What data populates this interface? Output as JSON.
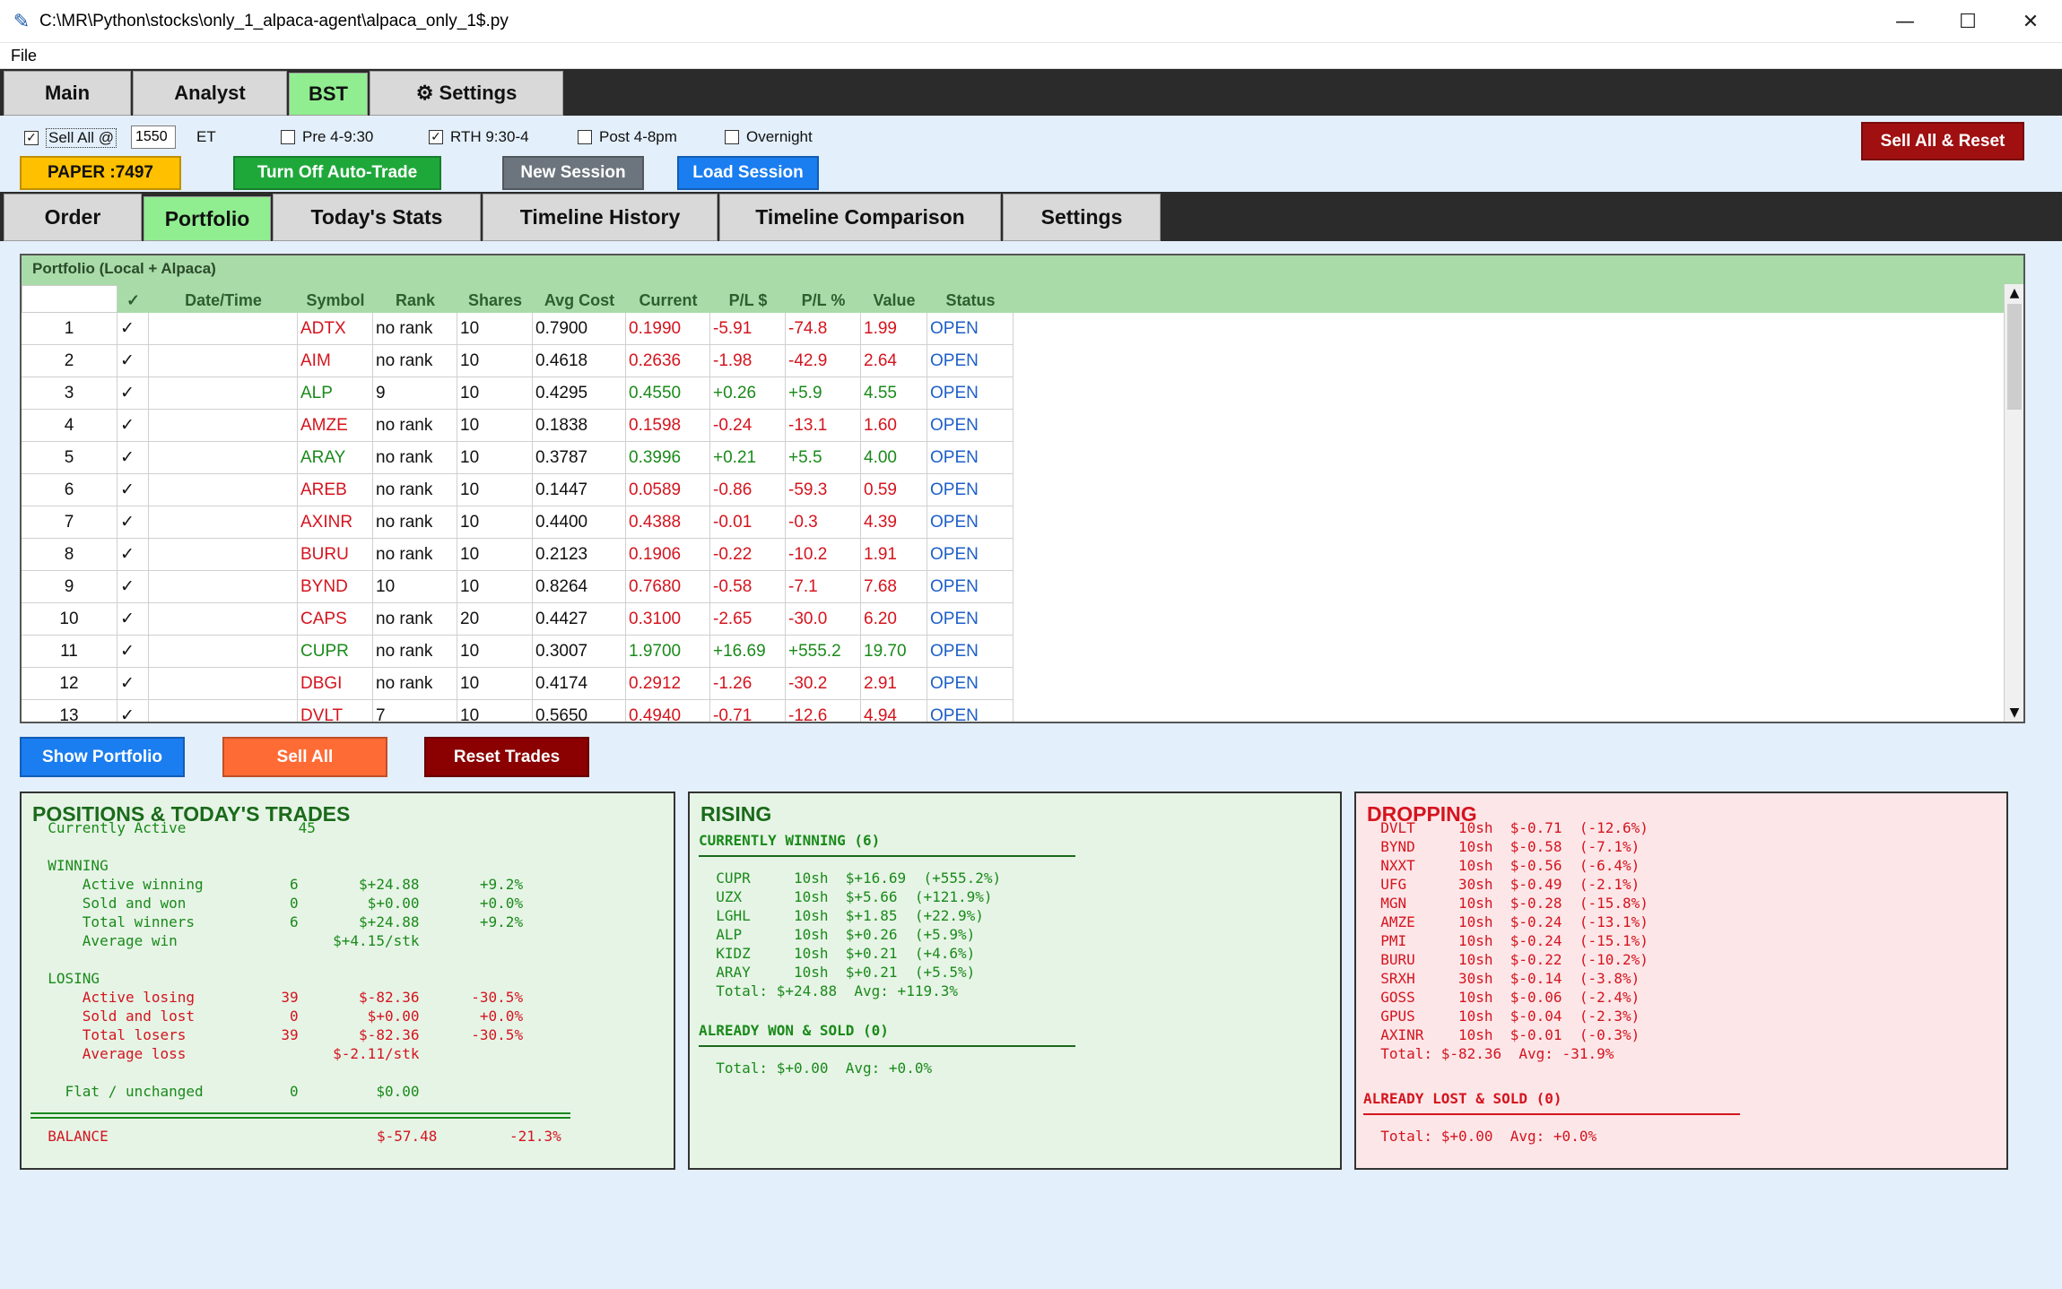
{
  "window": {
    "title": "C:\\MR\\Python\\stocks\\only_1_alpaca-agent\\alpaca_only_1$.py",
    "minimize": "—",
    "maximize": "☐",
    "close": "✕"
  },
  "menu": {
    "file": "File"
  },
  "top_tabs": [
    "Main",
    "Analyst",
    "BST",
    "⚙ Settings"
  ],
  "controls": {
    "sell_all_label": "Sell All @",
    "sell_all_time": "1550",
    "et_label": "ET",
    "pre_label": "Pre 4-9:30",
    "rth_label": "RTH 9:30-4",
    "post_label": "Post 4-8pm",
    "overnight_label": "Overnight",
    "sell_all_reset": "Sell All & Reset",
    "paper": "PAPER :7497",
    "auto_trade": "Turn Off Auto-Trade",
    "new_session": "New Session",
    "load_session": "Load Session",
    "check_mark": "✓"
  },
  "sub_tabs": [
    "Order",
    "Portfolio",
    "Today's Stats",
    "Timeline History",
    "Timeline Comparison",
    "Settings"
  ],
  "portfolio": {
    "title": "Portfolio (Local + Alpaca)",
    "columns": [
      "✓",
      "Date/Time",
      "Symbol",
      "Rank",
      "Shares",
      "Avg Cost",
      "Current",
      "P/L $",
      "P/L %",
      "Value",
      "Status"
    ],
    "rows": [
      {
        "n": "1",
        "chk": "✓",
        "dt": "",
        "sym": "ADTX",
        "rank": "no rank",
        "sh": "10",
        "avg": "0.7900",
        "cur": "0.1990",
        "pl": "-5.91",
        "plp": "-74.8",
        "val": "1.99",
        "st": "OPEN",
        "pos": false
      },
      {
        "n": "2",
        "chk": "✓",
        "dt": "",
        "sym": "AIM",
        "rank": "no rank",
        "sh": "10",
        "avg": "0.4618",
        "cur": "0.2636",
        "pl": "-1.98",
        "plp": "-42.9",
        "val": "2.64",
        "st": "OPEN",
        "pos": false
      },
      {
        "n": "3",
        "chk": "✓",
        "dt": "",
        "sym": "ALP",
        "rank": "9",
        "sh": "10",
        "avg": "0.4295",
        "cur": "0.4550",
        "pl": "+0.26",
        "plp": "+5.9",
        "val": "4.55",
        "st": "OPEN",
        "pos": true
      },
      {
        "n": "4",
        "chk": "✓",
        "dt": "",
        "sym": "AMZE",
        "rank": "no rank",
        "sh": "10",
        "avg": "0.1838",
        "cur": "0.1598",
        "pl": "-0.24",
        "plp": "-13.1",
        "val": "1.60",
        "st": "OPEN",
        "pos": false
      },
      {
        "n": "5",
        "chk": "✓",
        "dt": "",
        "sym": "ARAY",
        "rank": "no rank",
        "sh": "10",
        "avg": "0.3787",
        "cur": "0.3996",
        "pl": "+0.21",
        "plp": "+5.5",
        "val": "4.00",
        "st": "OPEN",
        "pos": true
      },
      {
        "n": "6",
        "chk": "✓",
        "dt": "",
        "sym": "AREB",
        "rank": "no rank",
        "sh": "10",
        "avg": "0.1447",
        "cur": "0.0589",
        "pl": "-0.86",
        "plp": "-59.3",
        "val": "0.59",
        "st": "OPEN",
        "pos": false
      },
      {
        "n": "7",
        "chk": "✓",
        "dt": "",
        "sym": "AXINR",
        "rank": "no rank",
        "sh": "10",
        "avg": "0.4400",
        "cur": "0.4388",
        "pl": "-0.01",
        "plp": "-0.3",
        "val": "4.39",
        "st": "OPEN",
        "pos": false
      },
      {
        "n": "8",
        "chk": "✓",
        "dt": "",
        "sym": "BURU",
        "rank": "no rank",
        "sh": "10",
        "avg": "0.2123",
        "cur": "0.1906",
        "pl": "-0.22",
        "plp": "-10.2",
        "val": "1.91",
        "st": "OPEN",
        "pos": false
      },
      {
        "n": "9",
        "chk": "✓",
        "dt": "",
        "sym": "BYND",
        "rank": "10",
        "sh": "10",
        "avg": "0.8264",
        "cur": "0.7680",
        "pl": "-0.58",
        "plp": "-7.1",
        "val": "7.68",
        "st": "OPEN",
        "pos": false
      },
      {
        "n": "10",
        "chk": "✓",
        "dt": "",
        "sym": "CAPS",
        "rank": "no rank",
        "sh": "20",
        "avg": "0.4427",
        "cur": "0.3100",
        "pl": "-2.65",
        "plp": "-30.0",
        "val": "6.20",
        "st": "OPEN",
        "pos": false
      },
      {
        "n": "11",
        "chk": "✓",
        "dt": "",
        "sym": "CUPR",
        "rank": "no rank",
        "sh": "10",
        "avg": "0.3007",
        "cur": "1.9700",
        "pl": "+16.69",
        "plp": "+555.2",
        "val": "19.70",
        "st": "OPEN",
        "pos": true
      },
      {
        "n": "12",
        "chk": "✓",
        "dt": "",
        "sym": "DBGI",
        "rank": "no rank",
        "sh": "10",
        "avg": "0.4174",
        "cur": "0.2912",
        "pl": "-1.26",
        "plp": "-30.2",
        "val": "2.91",
        "st": "OPEN",
        "pos": false
      },
      {
        "n": "13",
        "chk": "✓",
        "dt": "",
        "sym": "DVLT",
        "rank": "7",
        "sh": "10",
        "avg": "0.5650",
        "cur": "0.4940",
        "pl": "-0.71",
        "plp": "-12.6",
        "val": "4.94",
        "st": "OPEN",
        "pos": false
      }
    ]
  },
  "actions": {
    "show_portfolio": "Show Portfolio",
    "sell_all": "Sell All",
    "reset_trades": "Reset Trades"
  },
  "positions_panel": {
    "title": "POSITIONS & TODAY'S TRADES",
    "lines": [
      "  Currently Active             45",
      "",
      "  WINNING",
      "      Active winning          6       $+24.88       +9.2%",
      "      Sold and won            0        $+0.00       +0.0%",
      "      Total winners           6       $+24.88       +9.2%",
      "      Average win                  $+4.15/stk",
      "",
      "  LOSING",
      "      Active losing          39       $-82.36      -30.5%",
      "      Sold and lost           0        $+0.00       +0.0%",
      "      Total losers           39       $-82.36      -30.5%",
      "      Average loss                 $-2.11/stk",
      "",
      "    Flat / unchanged          0         $0.00"
    ],
    "balance_label": "  BALANCE",
    "balance_value": "$-57.48",
    "balance_pct": "-21.3%"
  },
  "rising_panel": {
    "title": "RISING",
    "subtitle": "CURRENTLY WINNING (6)",
    "lines": [
      "  CUPR     10sh  $+16.69  (+555.2%)",
      "  UZX      10sh  $+5.66  (+121.9%)",
      "  LGHL     10sh  $+1.85  (+22.9%)",
      "  ALP      10sh  $+0.26  (+5.9%)",
      "  KIDZ     10sh  $+0.21  (+4.6%)",
      "  ARAY     10sh  $+0.21  (+5.5%)",
      "  Total: $+24.88  Avg: +119.3%"
    ],
    "sold_title": "ALREADY WON & SOLD (0)",
    "sold_total": "  Total: $+0.00  Avg: +0.0%"
  },
  "dropping_panel": {
    "title": "DROPPING",
    "lines": [
      "  DVLT     10sh  $-0.71  (-12.6%)",
      "  BYND     10sh  $-0.58  (-7.1%)",
      "  NXXT     10sh  $-0.56  (-6.4%)",
      "  UFG      30sh  $-0.49  (-2.1%)",
      "  MGN      10sh  $-0.28  (-15.8%)",
      "  AMZE     10sh  $-0.24  (-13.1%)",
      "  PMI      10sh  $-0.24  (-15.1%)",
      "  BURU     10sh  $-0.22  (-10.2%)",
      "  SRXH     30sh  $-0.14  (-3.8%)",
      "  GOSS     10sh  $-0.06  (-2.4%)",
      "  GPUS     10sh  $-0.04  (-2.3%)",
      "  AXINR    10sh  $-0.01  (-0.3%)",
      "  Total: $-82.36  Avg: -31.9%"
    ],
    "sold_title": "ALREADY LOST & SOLD (0)",
    "sold_total": "  Total: $+0.00  Avg: +0.0%"
  },
  "colors": {
    "tab_active": "#90ee90",
    "paper": "#ffc000",
    "auto_trade": "#1fa83a",
    "new_session": "#6c757d",
    "load_session": "#1a7df0",
    "sell_all_reset": "#a01010",
    "show_portfolio": "#1a7df0",
    "sell_all": "#ff6b35",
    "reset_trades": "#8b0000",
    "positive": "#1a8a1a",
    "negative": "#d4141e",
    "status": "#1e5fc8"
  }
}
